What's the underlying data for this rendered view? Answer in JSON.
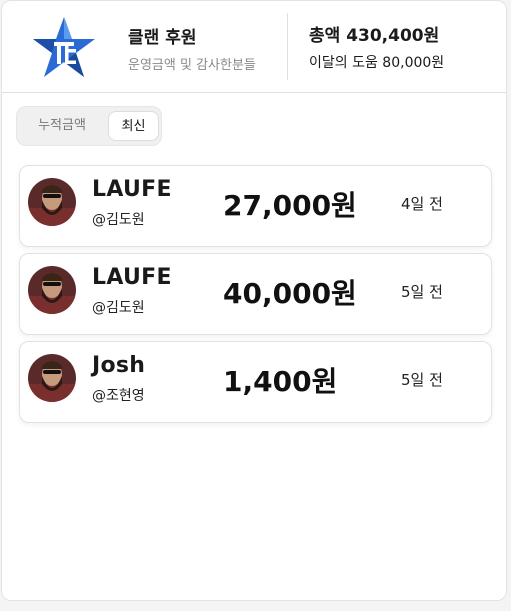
{
  "header": {
    "club_title": "클랜 후원",
    "club_subtitle": "운영금액 및 감사한분들",
    "total_label": "총액 430,400원",
    "month_label": "이달의 도움 80,000원"
  },
  "tabs": [
    {
      "label": "누적금액",
      "active": false
    },
    {
      "label": "최신",
      "active": true
    }
  ],
  "donations": [
    {
      "name": "LAUFE",
      "handle": "@김도원",
      "amount": "27,000원",
      "time": "4일 전"
    },
    {
      "name": "LAUFE",
      "handle": "@김도원",
      "amount": "40,000원",
      "time": "5일 전"
    },
    {
      "name": "Josh",
      "handle": "@조현영",
      "amount": "1,400원",
      "time": "5일 전"
    }
  ],
  "colors": {
    "logo_blue": "#1a56c4",
    "logo_light": "#4f8fe8",
    "card_border": "#e2e2e2"
  }
}
